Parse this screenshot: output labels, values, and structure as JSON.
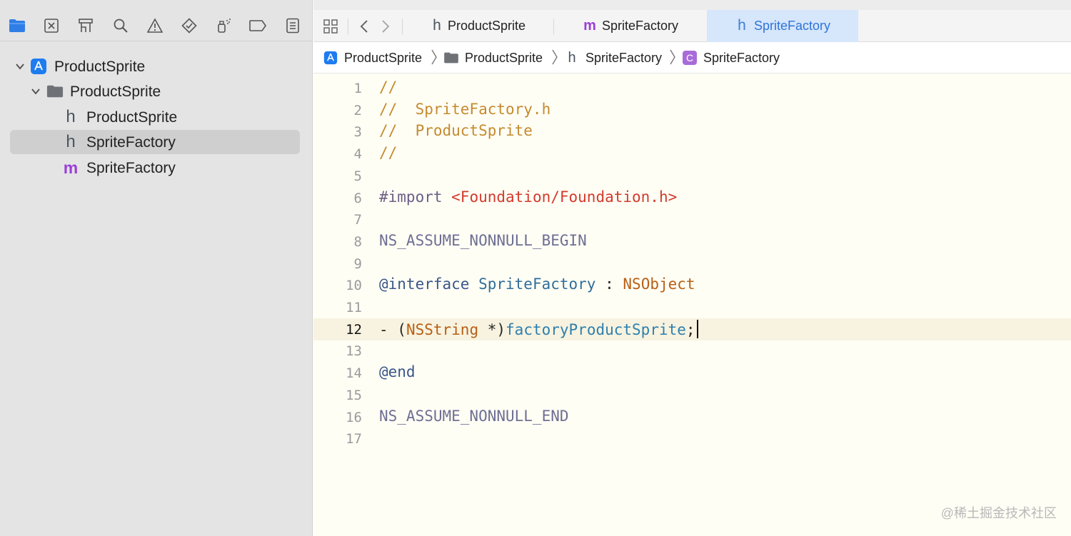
{
  "navigator": {
    "toolbar_icons": [
      "folder-icon",
      "source-control-icon",
      "symbol-navigator-icon",
      "search-icon",
      "issue-warning-icon",
      "test-diamond-icon",
      "debug-spray-icon",
      "breakpoint-icon",
      "report-icon"
    ],
    "tree": [
      {
        "label": "ProductSprite",
        "kind": "project",
        "expanded": true
      },
      {
        "label": "ProductSprite",
        "kind": "folder",
        "expanded": true
      },
      {
        "label": "ProductSprite",
        "kind": "header",
        "glyph": "h"
      },
      {
        "label": "SpriteFactory",
        "kind": "header",
        "glyph": "h",
        "selected": true
      },
      {
        "label": "SpriteFactory",
        "kind": "implementation",
        "glyph": "m"
      }
    ]
  },
  "tabs": [
    {
      "label": "ProductSprite",
      "glyph": "h"
    },
    {
      "label": "SpriteFactory",
      "glyph": "m"
    },
    {
      "label": "SpriteFactory",
      "glyph": "h",
      "active": true
    }
  ],
  "jumpbar": [
    {
      "label": "ProductSprite",
      "icon": "project-icon"
    },
    {
      "label": "ProductSprite",
      "icon": "folder-icon"
    },
    {
      "label": "SpriteFactory",
      "icon": "header-file-icon",
      "glyph": "h"
    },
    {
      "label": "SpriteFactory",
      "icon": "class-icon",
      "glyph": "C"
    }
  ],
  "editor": {
    "current_line": 12,
    "lines": [
      {
        "n": "1",
        "parts": [
          {
            "t": "//",
            "c": "comment"
          }
        ]
      },
      {
        "n": "2",
        "parts": [
          {
            "t": "//  SpriteFactory.h",
            "c": "comment"
          }
        ]
      },
      {
        "n": "3",
        "parts": [
          {
            "t": "//  ProductSprite",
            "c": "comment"
          }
        ]
      },
      {
        "n": "4",
        "parts": [
          {
            "t": "//",
            "c": "comment"
          }
        ]
      },
      {
        "n": "5",
        "parts": []
      },
      {
        "n": "6",
        "parts": [
          {
            "t": "#import ",
            "c": "prep"
          },
          {
            "t": "<Foundation/Foundation.h>",
            "c": "string"
          }
        ]
      },
      {
        "n": "7",
        "parts": []
      },
      {
        "n": "8",
        "parts": [
          {
            "t": "NS_ASSUME_NONNULL_BEGIN",
            "c": "macro"
          }
        ]
      },
      {
        "n": "9",
        "parts": []
      },
      {
        "n": "10",
        "parts": [
          {
            "t": "@interface",
            "c": "keyword"
          },
          {
            "t": " ",
            "c": "plain"
          },
          {
            "t": "SpriteFactory",
            "c": "classdef"
          },
          {
            "t": " : ",
            "c": "plain"
          },
          {
            "t": "NSObject",
            "c": "class"
          }
        ]
      },
      {
        "n": "11",
        "parts": []
      },
      {
        "n": "12",
        "parts": [
          {
            "t": "- (",
            "c": "plain"
          },
          {
            "t": "NSString",
            "c": "class"
          },
          {
            "t": " *)",
            "c": "plain"
          },
          {
            "t": "factoryProductSprite",
            "c": "method"
          },
          {
            "t": ";",
            "c": "plain"
          }
        ]
      },
      {
        "n": "13",
        "parts": []
      },
      {
        "n": "14",
        "parts": [
          {
            "t": "@end",
            "c": "keyword"
          }
        ]
      },
      {
        "n": "15",
        "parts": []
      },
      {
        "n": "16",
        "parts": [
          {
            "t": "NS_ASSUME_NONNULL_END",
            "c": "macro"
          }
        ]
      },
      {
        "n": "17",
        "parts": []
      }
    ]
  },
  "watermark": "@稀土掘金技术社区"
}
